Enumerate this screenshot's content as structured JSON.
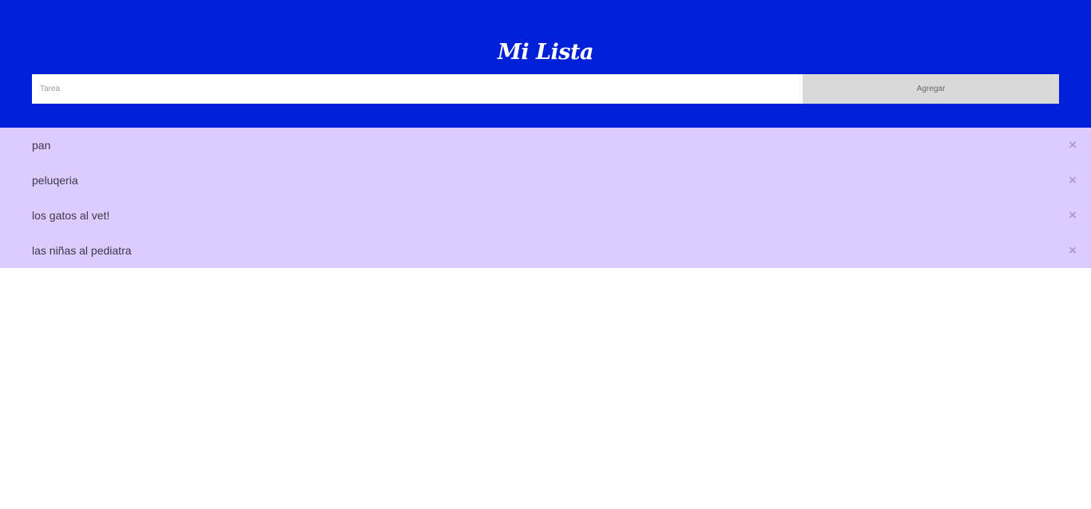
{
  "app": {
    "title": "Mi Lista"
  },
  "form": {
    "input_placeholder": "Tarea",
    "input_value": "",
    "add_label": "Agregar"
  },
  "tasks": [
    {
      "label": "pan",
      "remove_icon": "×"
    },
    {
      "label": "peluqeria",
      "remove_icon": "×"
    },
    {
      "label": "los gatos al vet!",
      "remove_icon": "×"
    },
    {
      "label": "las niñas al pediatra",
      "remove_icon": "×"
    }
  ],
  "icons": {
    "remove": "close-icon"
  },
  "colors": {
    "header_bg": "#0020d8",
    "list_bg": "#dccbfd",
    "button_bg": "#d9d9d9",
    "remove_icon": "#a99bd6"
  }
}
